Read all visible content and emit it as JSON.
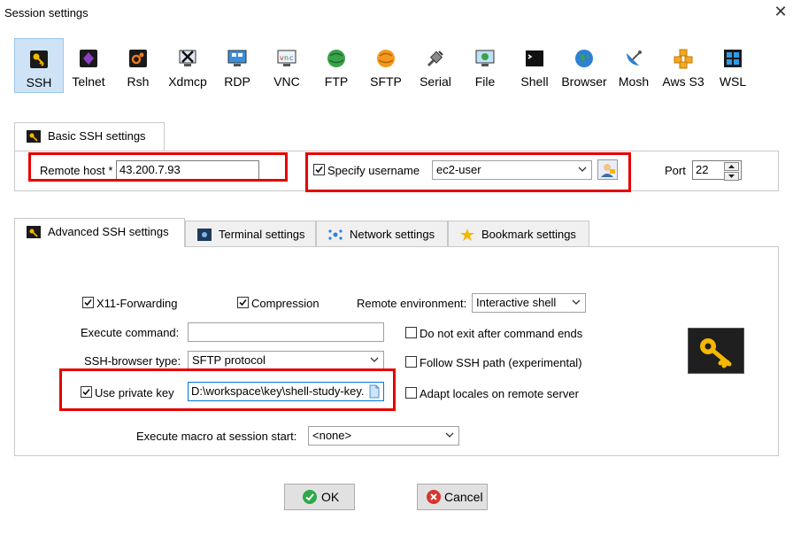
{
  "window": {
    "title": "Session settings"
  },
  "protocols": [
    {
      "label": "SSH",
      "icon": "ssh-key-icon",
      "selected": true
    },
    {
      "label": "Telnet",
      "icon": "telnet-icon"
    },
    {
      "label": "Rsh",
      "icon": "rsh-icon"
    },
    {
      "label": "Xdmcp",
      "icon": "xdmcp-icon"
    },
    {
      "label": "RDP",
      "icon": "rdp-icon"
    },
    {
      "label": "VNC",
      "icon": "vnc-icon"
    },
    {
      "label": "FTP",
      "icon": "ftp-globe-icon"
    },
    {
      "label": "SFTP",
      "icon": "sftp-globe-icon"
    },
    {
      "label": "Serial",
      "icon": "serial-plug-icon"
    },
    {
      "label": "File",
      "icon": "file-monitor-icon"
    },
    {
      "label": "Shell",
      "icon": "shell-terminal-icon"
    },
    {
      "label": "Browser",
      "icon": "browser-globe-icon"
    },
    {
      "label": "Mosh",
      "icon": "mosh-satellite-icon"
    },
    {
      "label": "Aws S3",
      "icon": "aws-s3-cubes-icon"
    },
    {
      "label": "WSL",
      "icon": "wsl-windows-icon"
    }
  ],
  "basic": {
    "tab_label": "Basic SSH settings",
    "remote_host_label": "Remote host *",
    "remote_host_value": "43.200.7.93",
    "specify_username_label": "Specify username",
    "specify_username_checked": true,
    "username_value": "ec2-user",
    "port_label": "Port",
    "port_value": "22"
  },
  "tabs": [
    {
      "label": "Advanced SSH settings",
      "icon": "key-icon",
      "active": true
    },
    {
      "label": "Terminal settings",
      "icon": "terminal-icon"
    },
    {
      "label": "Network settings",
      "icon": "network-icon"
    },
    {
      "label": "Bookmark settings",
      "icon": "star-icon"
    }
  ],
  "advanced": {
    "x11_label": "X11-Forwarding",
    "x11_checked": true,
    "compression_label": "Compression",
    "compression_checked": true,
    "remote_env_label": "Remote environment:",
    "remote_env_value": "Interactive shell",
    "execute_command_label": "Execute command:",
    "execute_command_value": "",
    "no_exit_label": "Do not exit after command ends",
    "browser_type_label": "SSH-browser type:",
    "browser_type_value": "SFTP protocol",
    "follow_path_label": "Follow SSH path (experimental)",
    "use_private_key_label": "Use private key",
    "use_private_key_checked": true,
    "private_key_value": "D:\\workspace\\key\\shell-study-key.",
    "adapt_locales_label": "Adapt locales on remote server",
    "macro_label": "Execute macro at session start:",
    "macro_value": "<none>"
  },
  "buttons": {
    "ok": "OK",
    "cancel": "Cancel"
  },
  "colors": {
    "highlight": "#e60000",
    "selected_bg": "#cfe3f7",
    "ok_green": "#2ea84a",
    "cancel_red": "#d9342b"
  }
}
